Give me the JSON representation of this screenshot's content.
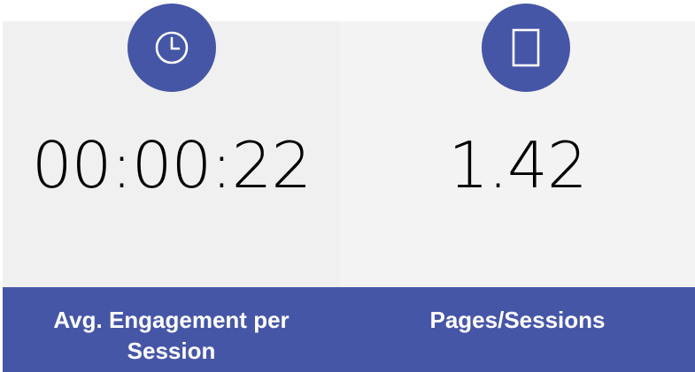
{
  "colors": {
    "accent": "#4656a6",
    "panel_left": "#f0f0f0",
    "panel_right": "#f3f3f3",
    "text": "#000000",
    "footer_text": "#ffffff"
  },
  "cards": [
    {
      "icon": "clock-icon",
      "value": "00:00:22",
      "label": "Avg. Engagement per Session"
    },
    {
      "icon": "page-icon",
      "value": "1.42",
      "label": "Pages/Sessions"
    }
  ]
}
